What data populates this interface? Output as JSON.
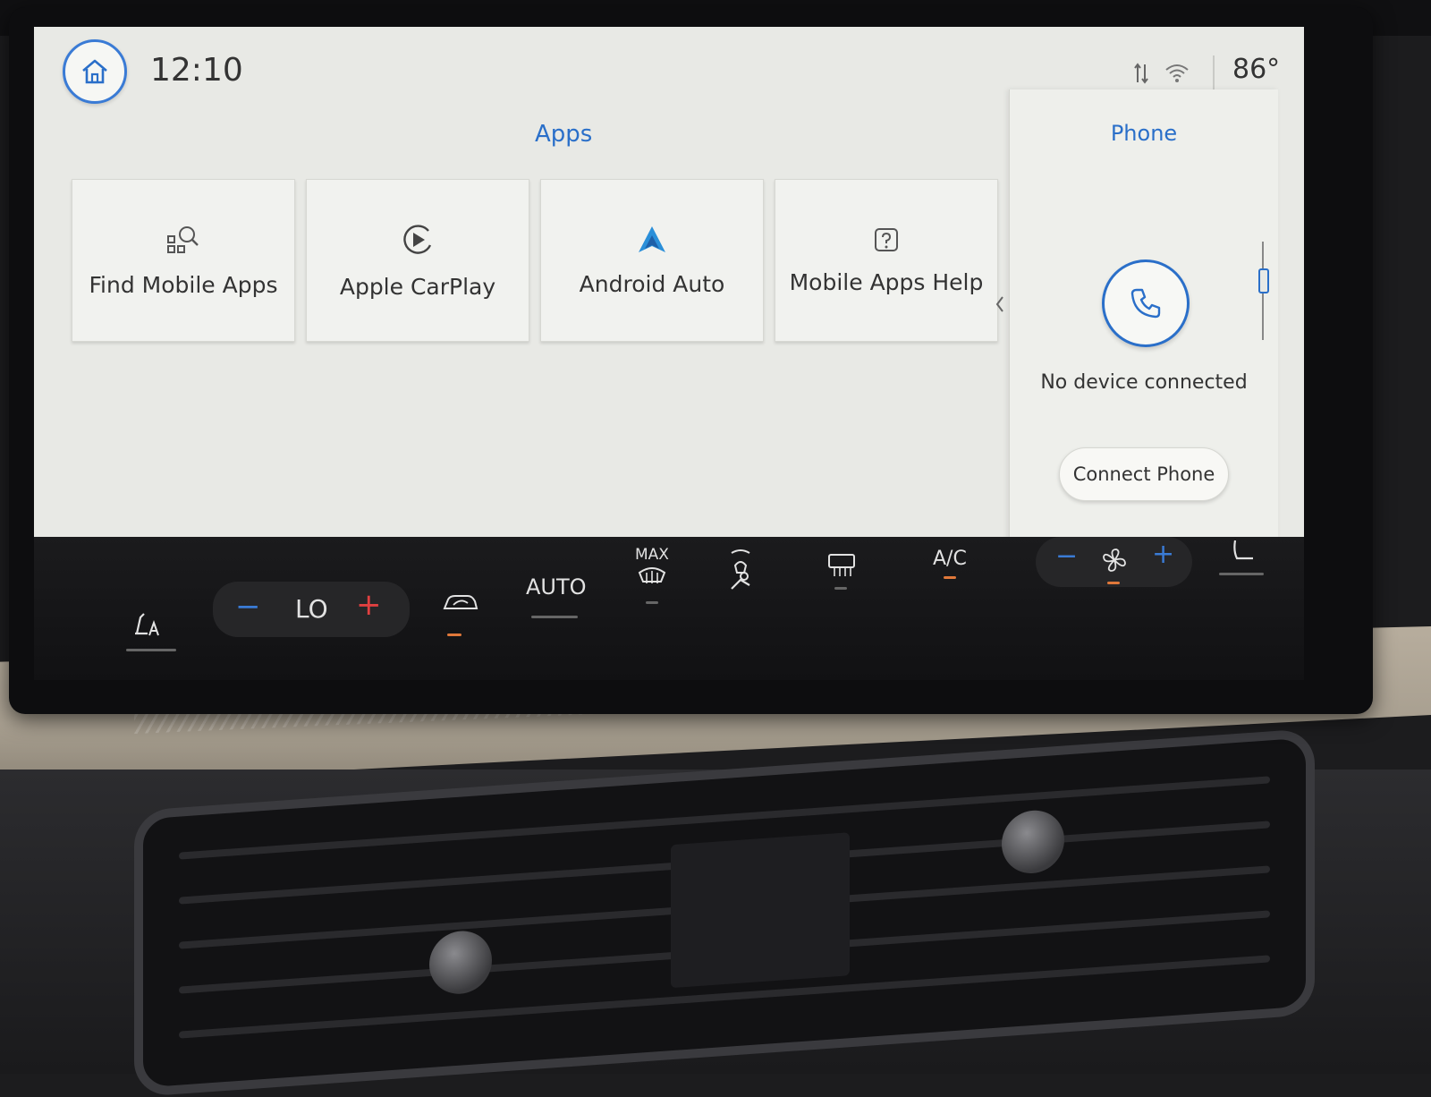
{
  "status_bar": {
    "time": "12:10",
    "outside_temp": "86°"
  },
  "apps": {
    "title": "Apps",
    "tiles": [
      {
        "label": "Find Mobile Apps",
        "icon": "app-search-icon"
      },
      {
        "label": "Apple CarPlay",
        "icon": "carplay-icon"
      },
      {
        "label": "Android Auto",
        "icon": "android-auto-icon"
      },
      {
        "label": "Mobile Apps Help",
        "icon": "help-icon"
      }
    ]
  },
  "phone": {
    "title": "Phone",
    "status": "No device connected",
    "connect_label": "Connect Phone"
  },
  "climate": {
    "temp_minus": "−",
    "temp_setting": "LO",
    "temp_plus": "+",
    "auto_label": "AUTO",
    "max_label": "MAX",
    "ac_label": "A/C",
    "fan_minus": "−",
    "fan_plus": "+"
  },
  "colors": {
    "accent_blue": "#2a6fc9",
    "indicator_orange": "#e0783a",
    "plus_red": "#e04040",
    "minus_blue": "#3a7bd5"
  }
}
